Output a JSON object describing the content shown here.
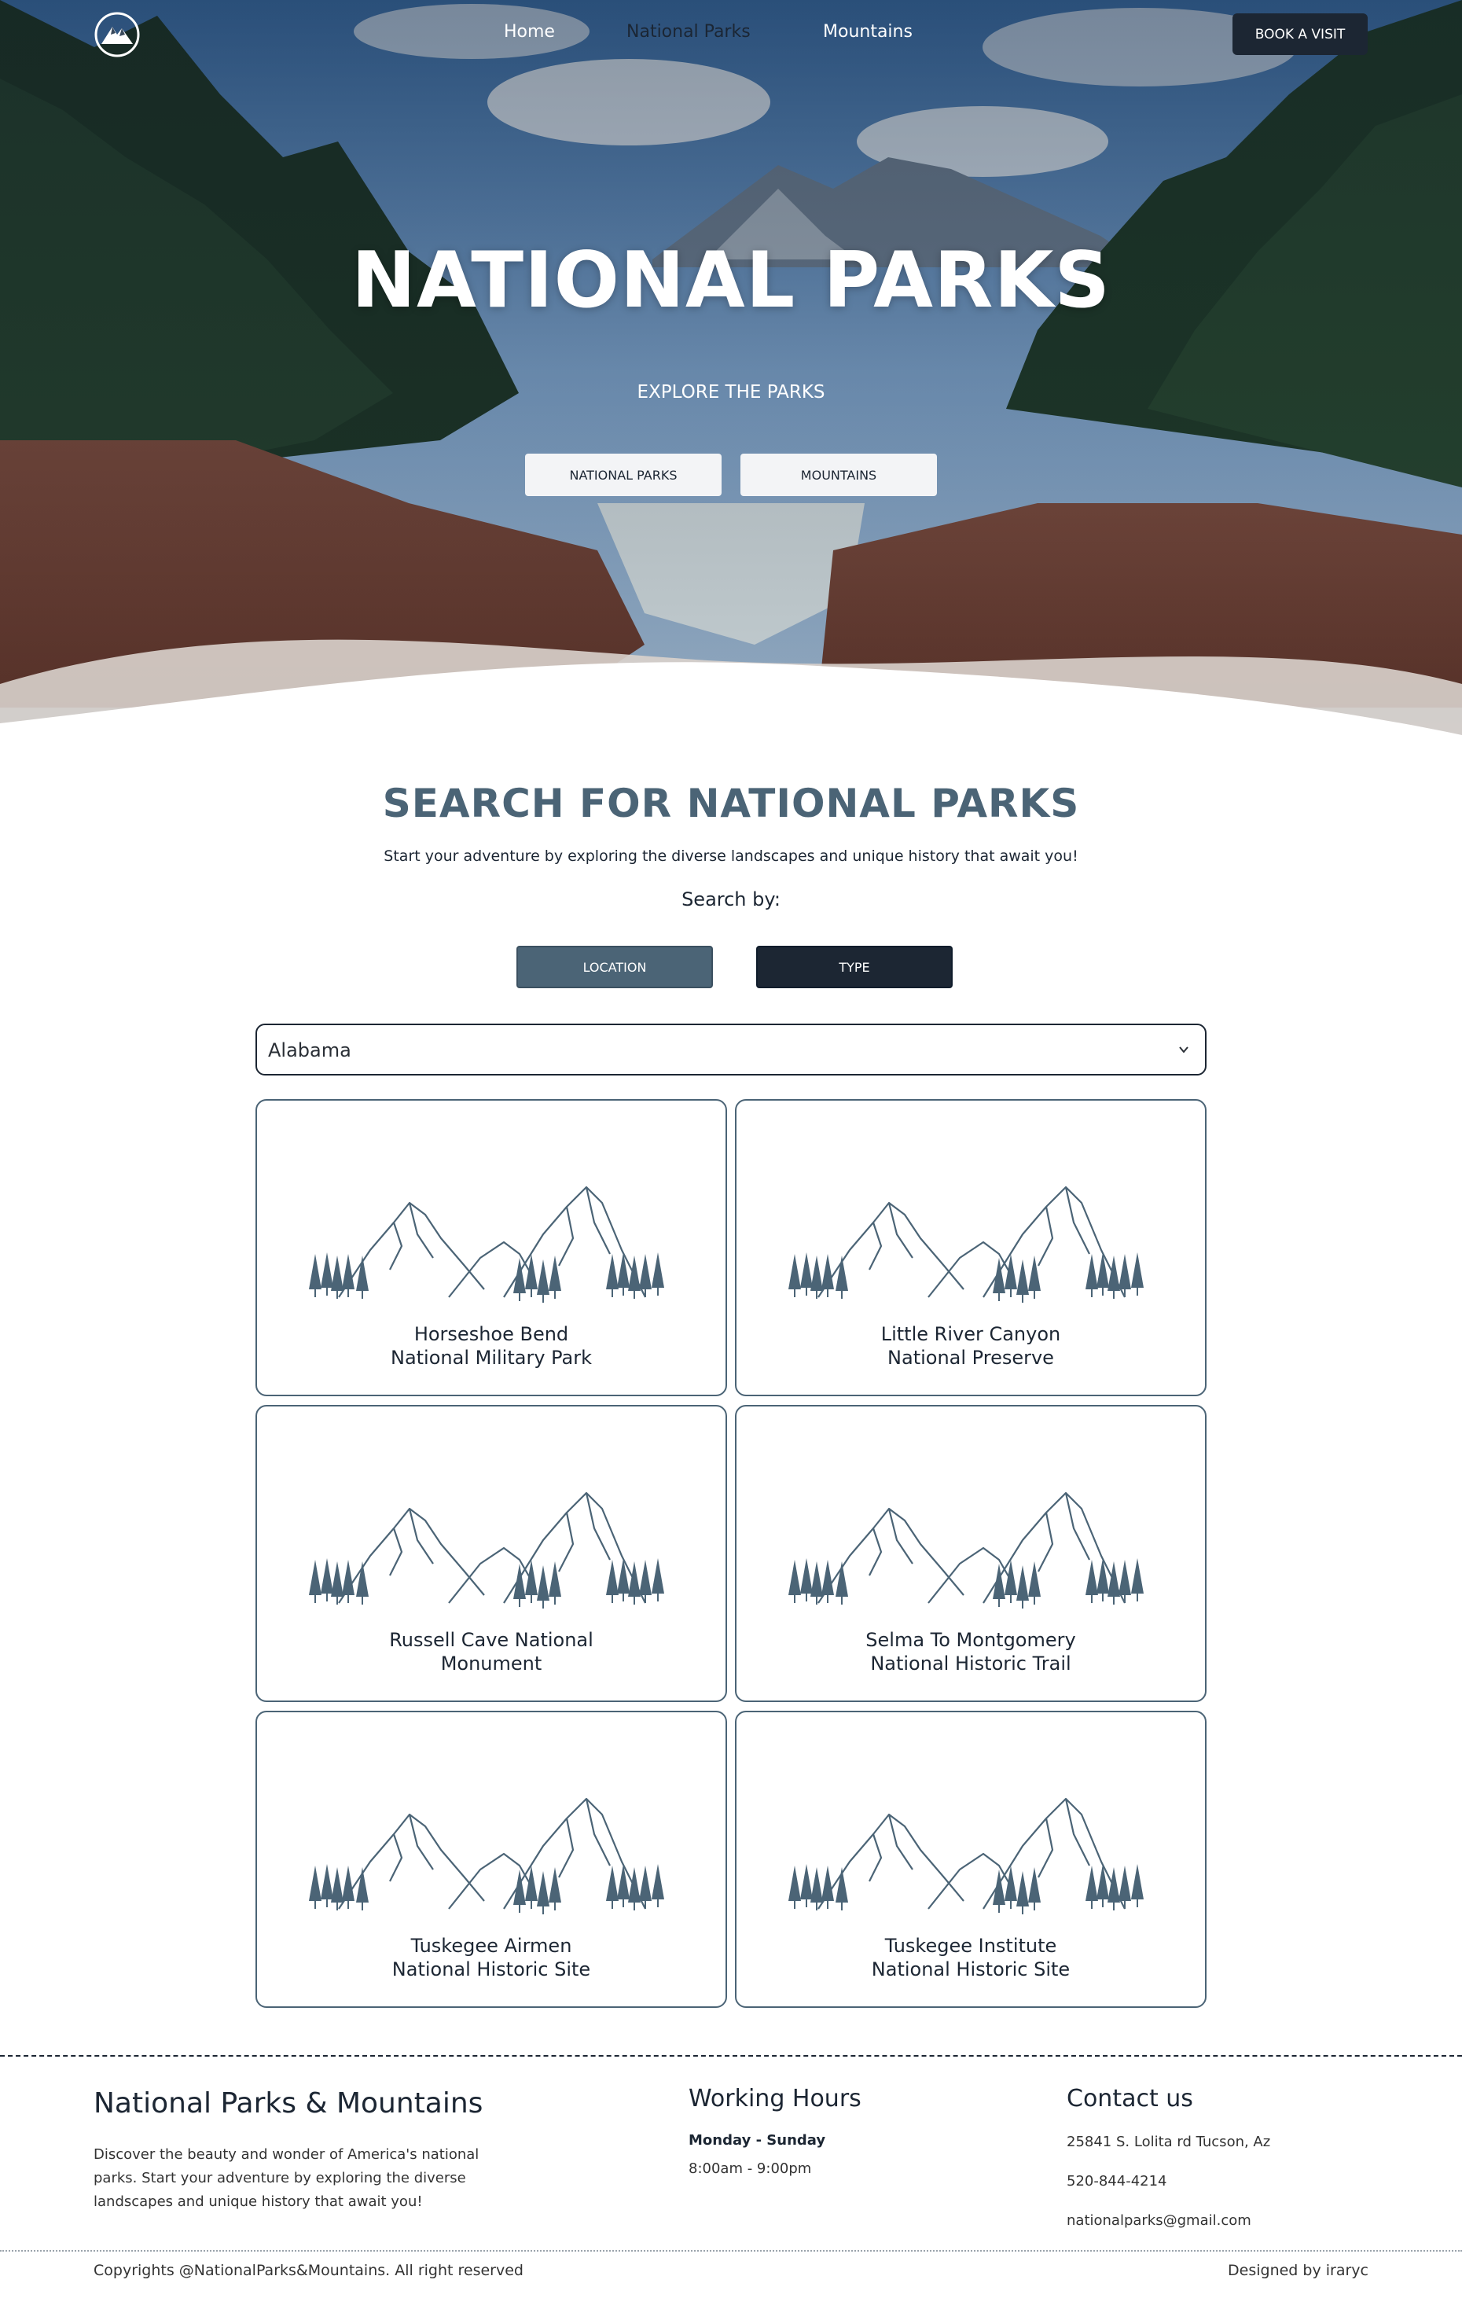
{
  "nav": {
    "links": [
      "Home",
      "National Parks",
      "Mountains"
    ],
    "active": "National Parks",
    "cta": "BOOK A VISIT"
  },
  "hero": {
    "title": "NATIONAL PARKS",
    "subtitle": "EXPLORE THE PARKS",
    "buttons": [
      "NATIONAL PARKS",
      "MOUNTAINS"
    ]
  },
  "search": {
    "title": "SEARCH FOR NATIONAL PARKS",
    "description": "Start your adventure by exploring the diverse landscapes and unique history that await you!",
    "search_by": "Search by:",
    "filters": [
      "LOCATION",
      "TYPE"
    ],
    "selected_state": "Alabama"
  },
  "parks": [
    {
      "line1": "Horseshoe Bend",
      "line2": "National Military Park"
    },
    {
      "line1": "Little River Canyon",
      "line2": "National Preserve"
    },
    {
      "line1": "Russell Cave National",
      "line2": "Monument"
    },
    {
      "line1": "Selma To Montgomery",
      "line2": "National Historic Trail"
    },
    {
      "line1": "Tuskegee Airmen",
      "line2": "National Historic Site"
    },
    {
      "line1": "Tuskegee Institute",
      "line2": "National Historic Site"
    }
  ],
  "footer": {
    "brand": "National Parks & Mountains",
    "about": "Discover the beauty and wonder of America's national parks. Start your adventure by exploring the diverse landscapes and unique history that await you!",
    "hours_title": "Working Hours",
    "days": "Monday - Sunday",
    "hours": "8:00am - 9:00pm",
    "contact_title": "Contact us",
    "address": "25841 S. Lolita rd Tucson, Az",
    "phone": "520-844-4214",
    "email": "nationalparks@gmail.com",
    "copyright": "Copyrights @NationalParks&Mountains. All right reserved",
    "designed_by": "Designed by iraryc"
  },
  "colors": {
    "primary_dark": "#1c2633",
    "slate": "#4b6476"
  },
  "icons": [
    "mountain-logo-icon",
    "chevron-down-icon",
    "mountain-illustration-icon"
  ]
}
